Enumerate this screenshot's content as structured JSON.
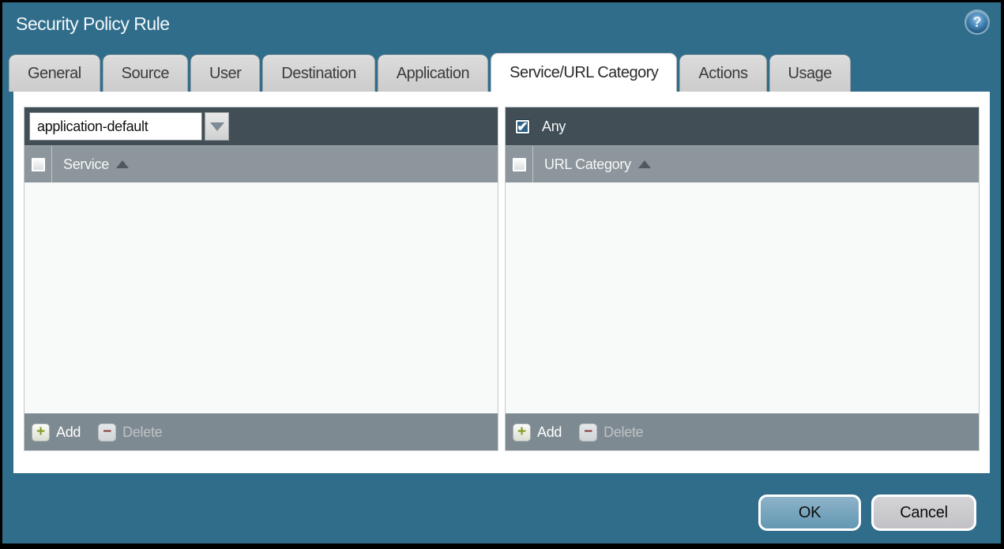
{
  "dialog": {
    "title": "Security Policy Rule",
    "help_icon": "?"
  },
  "tabs": [
    {
      "label": "General",
      "active": false
    },
    {
      "label": "Source",
      "active": false
    },
    {
      "label": "User",
      "active": false
    },
    {
      "label": "Destination",
      "active": false
    },
    {
      "label": "Application",
      "active": false
    },
    {
      "label": "Service/URL Category",
      "active": true
    },
    {
      "label": "Actions",
      "active": false
    },
    {
      "label": "Usage",
      "active": false
    }
  ],
  "service_panel": {
    "select_value": "application-default",
    "column": "Service",
    "sort": "ascending",
    "header_checkbox_checked": false,
    "rows": [],
    "add_label": "Add",
    "delete_label": "Delete",
    "delete_enabled": false
  },
  "url_category_panel": {
    "any_label": "Any",
    "any_checked": true,
    "column": "URL Category",
    "sort": "ascending",
    "header_checkbox_checked": false,
    "rows": [],
    "add_label": "Add",
    "delete_label": "Delete",
    "delete_enabled": false
  },
  "buttons": {
    "ok": "OK",
    "cancel": "Cancel"
  },
  "icons": {
    "check": "✔",
    "plus": "+",
    "minus": "−"
  },
  "colors": {
    "frame_teal": "#2f6d8b",
    "panel_header_dark": "#414e55",
    "column_header_gray": "#8d969c",
    "footer_bar_gray": "#7e8a91",
    "ok_button_blue": "#6fa0ba",
    "cancel_button_gray": "#c9c9cc",
    "add_icon_green": "#7f9c1c",
    "delete_icon_red": "#8c3a3a",
    "checked_checkbox_blue": "#2d6186"
  }
}
